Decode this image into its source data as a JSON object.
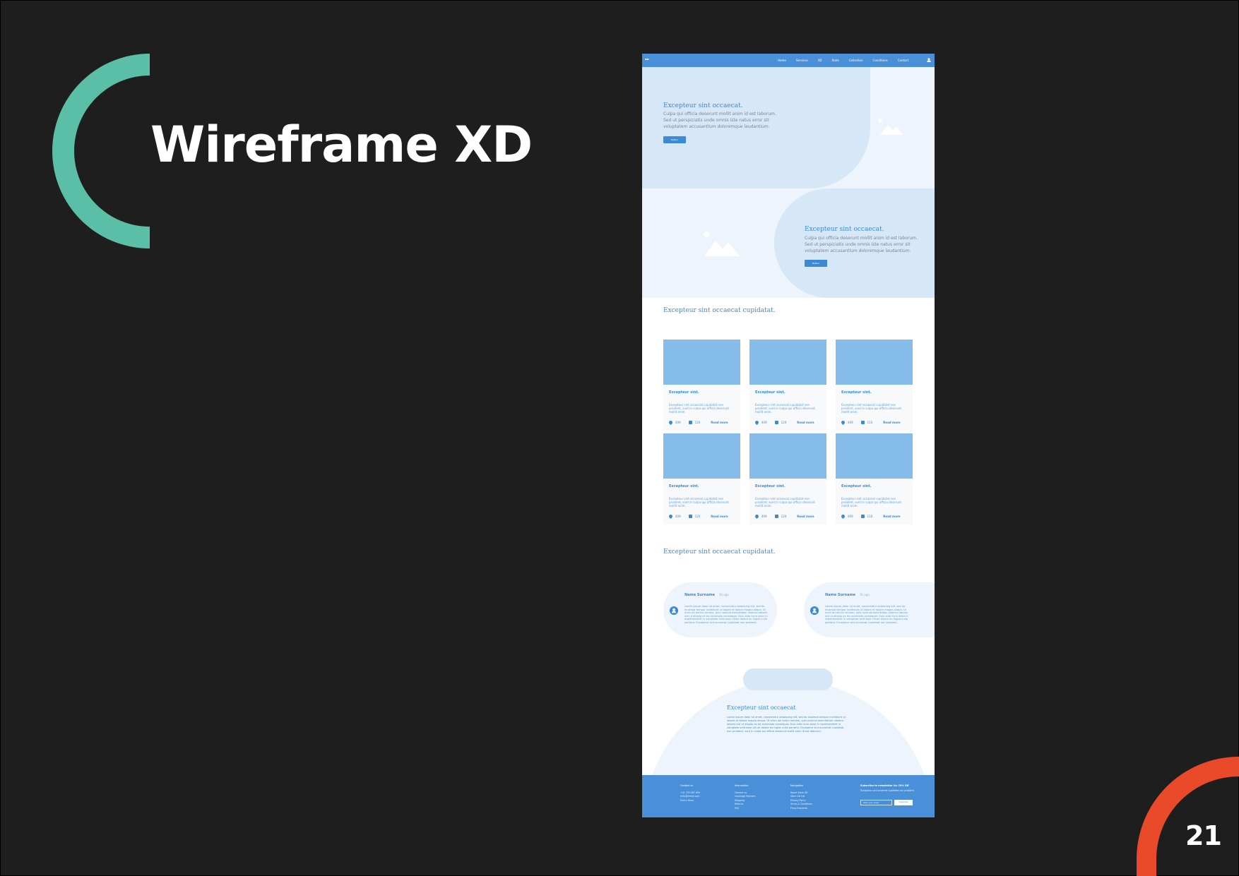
{
  "slide": {
    "title": "Wireframe XD",
    "page_number": "21",
    "colors": {
      "background": "#1e1e1e",
      "teal_arc": "#5bbfa7",
      "red_arc": "#e84a2a",
      "text": "#ffffff"
    }
  },
  "wireframe": {
    "colors": {
      "primary": "#4a90d9",
      "accent": "#3b8ad6",
      "light": "#d6e7f7",
      "lighter": "#eef4fb",
      "image": "#86bcea"
    },
    "nav": {
      "logo": "▪▪",
      "links": [
        "Home",
        "Services",
        "XD",
        "Stats",
        "Collection",
        "Conditions",
        "Contact"
      ],
      "user_icon": "user-icon"
    },
    "hero1": {
      "title": "Excepteur sint occaecat.",
      "lines": [
        "Culpa qui officia deserunt mollit anim id est laborum.",
        "Sed ut perspiciatis unde omnis iste natus error sit",
        "voluptatem accusantium doloremque laudantium."
      ],
      "button": "Button"
    },
    "hero2": {
      "title": "Excepteur sint occaecat.",
      "lines": [
        "Culpa qui officia deserunt mollit anim id est laborum.",
        "Sed ut perspiciatis unde omnis iste natus error sit",
        "voluptatem accusantium doloremque laudantium."
      ],
      "button": "Button"
    },
    "cards_section": {
      "title": "Excepteur sint occaecat cupidatat.",
      "cards": [
        {
          "title": "Excepteur sint.",
          "text": "Excepteur sint occaecat cupidatat non proident, sunt in culpa qui officia deserunt mollit anim.",
          "likes": "409",
          "comments": "120",
          "link": "Read more"
        },
        {
          "title": "Excepteur sint.",
          "text": "Excepteur sint occaecat cupidatat non proident, sunt in culpa qui officia deserunt mollit anim.",
          "likes": "409",
          "comments": "120",
          "link": "Read more"
        },
        {
          "title": "Excepteur sint.",
          "text": "Excepteur sint occaecat cupidatat non proident, sunt in culpa qui officia deserunt mollit anim.",
          "likes": "409",
          "comments": "110",
          "link": "Read more"
        },
        {
          "title": "Excepteur sint.",
          "text": "Excepteur sint occaecat cupidatat non proident, sunt in culpa qui officia deserunt mollit anim.",
          "likes": "409",
          "comments": "120",
          "link": "Read more"
        },
        {
          "title": "Excepteur sint.",
          "text": "Excepteur sint occaecat cupidatat non proident, sunt in culpa qui officia deserunt mollit anim.",
          "likes": "409",
          "comments": "120",
          "link": "Read more"
        },
        {
          "title": "Excepteur sint.",
          "text": "Excepteur sint occaecat cupidatat non proident, sunt in culpa qui officia deserunt mollit anim.",
          "likes": "409",
          "comments": "110",
          "link": "Read more"
        }
      ]
    },
    "testimonials_section": {
      "title": "Excepteur sint occaecat cupidatat.",
      "items": [
        {
          "name": "Name Surname",
          "time": "1h ago",
          "text": "Lorem ipsum dolor sit amet, consectetur adipiscing elit, sed do eiusmod tempor incididunt ut labore et dolore magna aliqua. Ut enim ad minim veniam, quis nostrud exercitation ullamco laboris nisi ut aliquip ex ea commodo consequat. Duis aute irure dolor in reprehenderit in voluptate velit esse cillum dolore eu fugiat nulla pariatur. Excepteur sint occaecat cupidatat non proident."
        },
        {
          "name": "Name Surname",
          "time": "1h ago",
          "text": "Lorem ipsum dolor sit amet, consectetur adipiscing elit, sed do eiusmod tempor incididunt ut labore et dolore magna aliqua. Ut enim ad minim veniam, quis nostrud exercitation ullamco laboris nisi ut aliquip ex ea commodo consequat. Duis aute irure dolor in reprehenderit in voluptate velit esse cillum dolore eu fugiat nulla pariatur. Excepteur sint occaecat cupidatat non proident."
        }
      ]
    },
    "cta": {
      "title": "Excepteur sint occaecat",
      "text": "Lorem ipsum dolor sit amet, consectetur adipiscing elit, sed do eiusmod tempor incididunt ut labore et dolore magna aliqua. Ut enim ad minim veniam, quis nostrud exercitation ullamco laboris nisi ut aliquip ex ea commodo consequat. Duis aute irure dolor in reprehenderit in voluptate velit esse cillum dolore eu fugiat nulla pariatur. Excepteur sint occaecat cupidatat non proident, sunt in culpa qui officia deserunt mollit anim id est laborum."
    },
    "footer": {
      "col1": {
        "head": "Contact us",
        "items": [
          "+01 234 567 890",
          "hello@email.com",
          "Find a Store"
        ]
      },
      "col2": {
        "head": "Information",
        "items": [
          "Contact us",
          "Coverage Partners",
          "Shipping",
          "Returns",
          "FAQ"
        ]
      },
      "col3": {
        "head": "Navigation",
        "items": [
          "About Store XD",
          "Store XD Ltd",
          "Privacy Policy",
          "Terms & Conditions",
          "Press Enquiries"
        ]
      },
      "newsletter": {
        "head": "Subscribe to newsletter for 10% Off",
        "sub": "Excepteur sint occaecat cupidatat non proident.",
        "placeholder": "Enter your email",
        "button": "Subscribe"
      }
    }
  }
}
